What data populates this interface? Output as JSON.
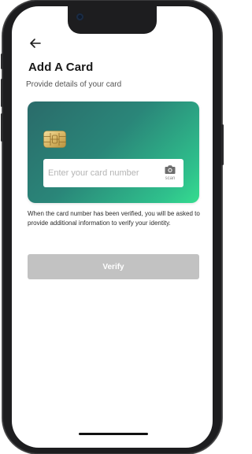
{
  "header": {
    "back_icon": "arrow-left-icon",
    "title": "Add A Card",
    "subtitle": "Provide details of your card"
  },
  "card": {
    "chip_icon": "card-chip-icon",
    "gradient_start": "#2a6b6a",
    "gradient_end": "#35dd8f",
    "number_input": {
      "value": "",
      "placeholder": "Enter your card number"
    },
    "scan": {
      "icon": "camera-icon",
      "label": "scan"
    }
  },
  "info_text": "When the card number has been verified, you will be asked to provide additional information to verify your identity.",
  "verify_button": {
    "label": "Verify",
    "color": "#c2c2c2"
  }
}
